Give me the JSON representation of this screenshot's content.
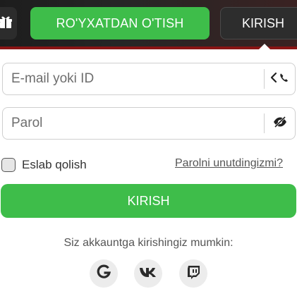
{
  "header": {
    "register_label": "RO'YXATDAN O'TISH",
    "login_label": "KIRISH",
    "gift_icon": "gift-icon"
  },
  "form": {
    "login_placeholder": "E-mail yoki ID",
    "password_placeholder": "Parol",
    "remember_label": "Eslab qolish",
    "forgot_label": "Parolni unutdingizmi?",
    "submit_label": "KIRISH"
  },
  "social": {
    "prompt": "Siz akkauntga kirishingiz mumkin:",
    "providers": [
      "google-icon",
      "vk-icon",
      "twitch-icon"
    ]
  },
  "colors": {
    "accent_green": "#3ebd4a",
    "dark_header": "#1d1d1d",
    "red_stripe": "#8a1414"
  }
}
